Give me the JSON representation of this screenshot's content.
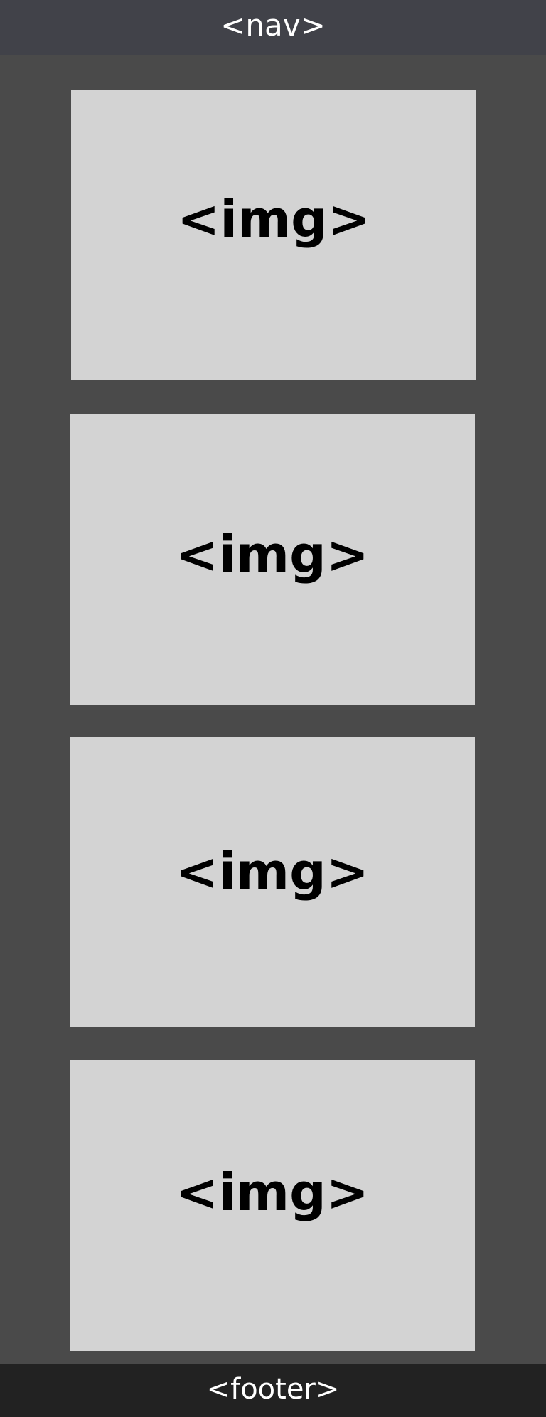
{
  "nav": {
    "label": "<nav>"
  },
  "main": {
    "images": [
      {
        "label": "<img>"
      },
      {
        "label": "<img>"
      },
      {
        "label": "<img>"
      },
      {
        "label": "<img>"
      }
    ]
  },
  "footer": {
    "label": "<footer>"
  },
  "colors": {
    "nav_background": "#414249",
    "main_background": "#4a4a4a",
    "image_placeholder": "#d3d3d3",
    "footer_background": "#222222",
    "nav_text": "#ffffff",
    "image_text": "#000000"
  }
}
